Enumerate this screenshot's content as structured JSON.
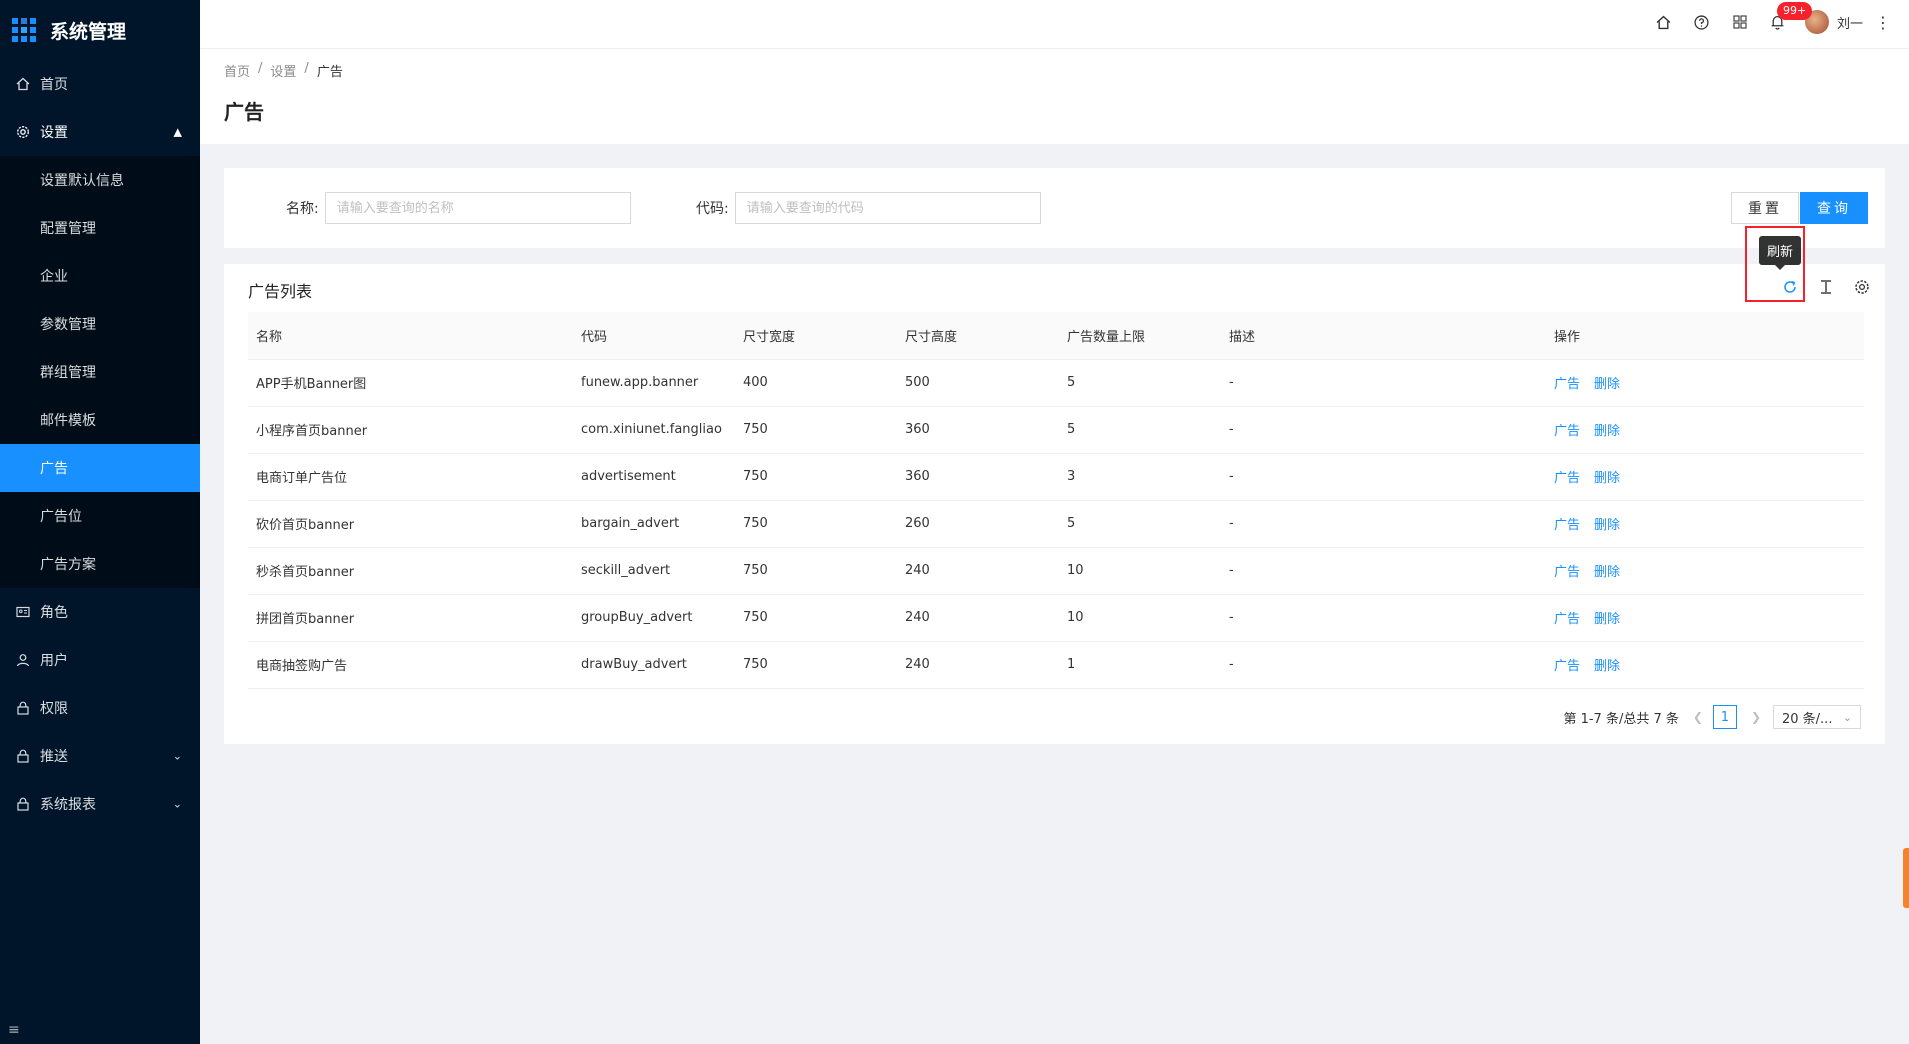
{
  "app": {
    "title": "系统管理"
  },
  "sidebar": {
    "items": [
      {
        "label": "首页",
        "icon": "home-icon"
      },
      {
        "label": "设置",
        "icon": "gear-icon",
        "expanded": true
      },
      {
        "label": "角色",
        "icon": "id-card-icon"
      },
      {
        "label": "用户",
        "icon": "user-icon"
      },
      {
        "label": "权限",
        "icon": "lock-icon"
      },
      {
        "label": "推送",
        "icon": "lock-icon",
        "has_children": true
      },
      {
        "label": "系统报表",
        "icon": "lock-icon",
        "has_children": true
      }
    ],
    "settings_children": [
      {
        "label": "设置默认信息"
      },
      {
        "label": "配置管理"
      },
      {
        "label": "企业"
      },
      {
        "label": "参数管理"
      },
      {
        "label": "群组管理"
      },
      {
        "label": "邮件模板"
      },
      {
        "label": "广告",
        "active": true
      },
      {
        "label": "广告位"
      },
      {
        "label": "广告方案"
      }
    ]
  },
  "header": {
    "notification_badge": "99+",
    "username": "刘一"
  },
  "breadcrumb": [
    "首页",
    "设置",
    "广告"
  ],
  "page_title": "广告",
  "search": {
    "name_label": "名称:",
    "name_placeholder": "请输入要查询的名称",
    "code_label": "代码:",
    "code_placeholder": "请输入要查询的代码",
    "reset_label": "重置",
    "query_label": "查询"
  },
  "tooltip": {
    "text": "刷新"
  },
  "table": {
    "title": "广告列表",
    "columns": [
      "名称",
      "代码",
      "尺寸宽度",
      "尺寸高度",
      "广告数量上限",
      "描述",
      "操作"
    ],
    "rows": [
      [
        "APP手机Banner图",
        "funew.app.banner",
        "400",
        "500",
        "5",
        "-"
      ],
      [
        "小程序首页banner",
        "com.xiniunet.fangliao",
        "750",
        "360",
        "5",
        "-"
      ],
      [
        "电商订单广告位",
        "advertisement",
        "750",
        "360",
        "3",
        "-"
      ],
      [
        "砍价首页banner",
        "bargain_advert",
        "750",
        "260",
        "5",
        "-"
      ],
      [
        "秒杀首页banner",
        "seckill_advert",
        "750",
        "240",
        "10",
        "-"
      ],
      [
        "拼团首页banner",
        "groupBuy_advert",
        "750",
        "240",
        "10",
        "-"
      ],
      [
        "电商抽签购广告",
        "drawBuy_advert",
        "750",
        "240",
        "1",
        "-"
      ]
    ],
    "action_ad": "广告",
    "action_delete": "删除"
  },
  "pagination": {
    "summary": "第 1-7 条/总共 7 条",
    "current_page": "1",
    "page_size": "20 条/..."
  },
  "colors": {
    "primary": "#1890ff",
    "sidebar_bg": "#001529",
    "danger": "#f5222d"
  }
}
